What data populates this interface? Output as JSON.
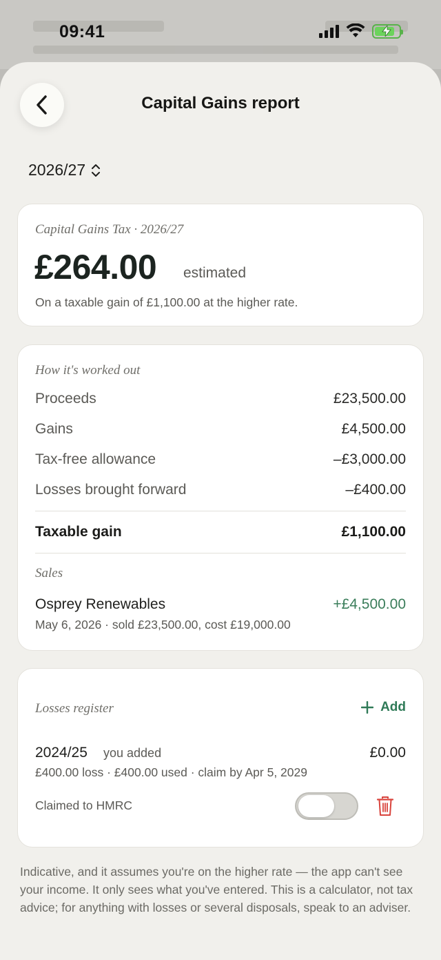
{
  "status_bar": {
    "time": "09:41"
  },
  "header": {
    "title": "Capital Gains report"
  },
  "year_picker": {
    "value": "2026/27"
  },
  "summary": {
    "label": "Capital Gains Tax · 2026/27",
    "amount": "£264.00",
    "amount_suffix": "estimated",
    "note": "On a taxable gain of £1,100.00 at the higher rate."
  },
  "breakdown": {
    "heading": "How it's worked out",
    "rows": [
      {
        "label": "Proceeds",
        "value": "£23,500.00"
      },
      {
        "label": "Gains",
        "value": "£4,500.00"
      },
      {
        "label": "Tax-free allowance",
        "value": "–£3,000.00"
      },
      {
        "label": "Losses brought forward",
        "value": "–£400.00"
      }
    ],
    "total": {
      "label": "Taxable gain",
      "value": "£1,100.00"
    },
    "sales_heading": "Sales",
    "sales": [
      {
        "name": "Osprey Renewables",
        "gain": "+£4,500.00",
        "detail": "May 6, 2026 · sold £23,500.00, cost £19,000.00"
      }
    ]
  },
  "losses": {
    "heading": "Losses register",
    "add_label": "Add",
    "items": [
      {
        "year": "2024/25",
        "badge": "you added",
        "amount": "£0.00",
        "detail": "£400.00 loss · £400.00 used  · claim by Apr 5, 2029",
        "claimed_label": "Claimed to HMRC",
        "claimed": false
      }
    ]
  },
  "disclaimer": "Indicative, and it assumes you're on the higher rate — the app can't see your income. It only sees what you've entered. This is a calculator, not tax advice; for anything with losses or several disposals, speak to an adviser.",
  "colors": {
    "accent_green": "#2f7a57",
    "gain_green": "#3a7d5a",
    "danger_red": "#d9433c",
    "sheet_bg": "#f1f0ec"
  },
  "icons": {
    "back": "chevron-left-icon",
    "picker": "chevron-up-down-icon",
    "add": "plus-icon",
    "delete": "trash-icon"
  }
}
